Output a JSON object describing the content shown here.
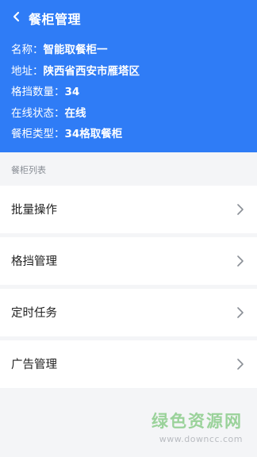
{
  "header": {
    "title": "餐柜管理",
    "info": [
      {
        "label": "名称：",
        "value": "智能取餐柜一"
      },
      {
        "label": "地址：",
        "value": "陕西省西安市雁塔区"
      },
      {
        "label": "格挡数量：",
        "value": "34"
      },
      {
        "label": "在线状态：",
        "value": "在线"
      },
      {
        "label": "餐柜类型：",
        "value": "34格取餐柜"
      }
    ]
  },
  "section_label": "餐柜列表",
  "menu": [
    {
      "label": "批量操作"
    },
    {
      "label": "格挡管理"
    },
    {
      "label": "定时任务"
    },
    {
      "label": "广告管理"
    }
  ],
  "watermark": {
    "logo": "绿色资源网",
    "url": "www.downcc.com"
  },
  "colors": {
    "brand": "#2f7cf6",
    "background": "#f4f5f7"
  }
}
